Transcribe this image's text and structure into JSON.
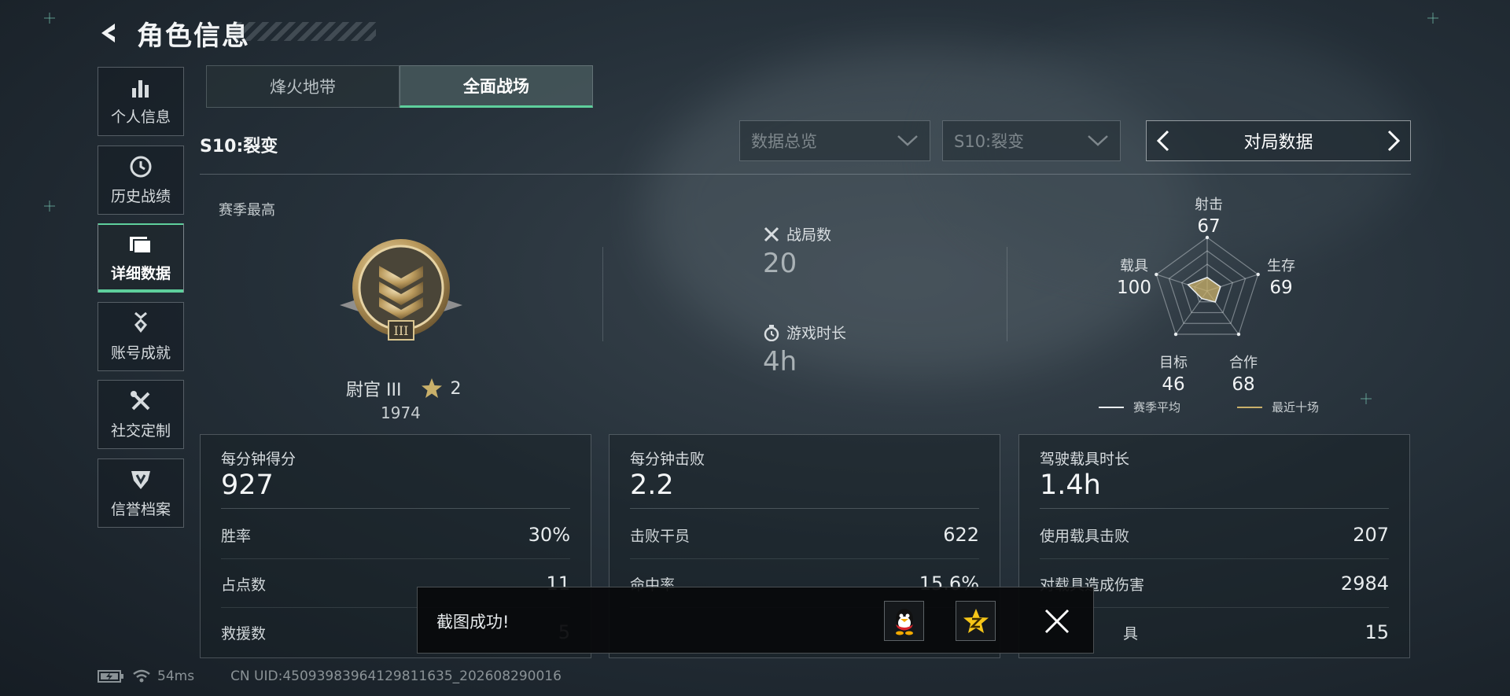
{
  "header": {
    "title": "角色信息"
  },
  "sidebar": {
    "items": [
      {
        "label": "个人信息",
        "icon": "bar-chart-icon"
      },
      {
        "label": "历史战绩",
        "icon": "clock-icon"
      },
      {
        "label": "详细数据",
        "icon": "folder-icon",
        "active": true
      },
      {
        "label": "账号成就",
        "icon": "medal-icon"
      },
      {
        "label": "社交定制",
        "icon": "tools-icon"
      },
      {
        "label": "信誉档案",
        "icon": "shield-icon"
      }
    ]
  },
  "tabs": [
    {
      "label": "烽火地带"
    },
    {
      "label": "全面战场",
      "active": true
    }
  ],
  "filters": {
    "season_label": "S10:裂变",
    "dropdown_overview": "数据总览",
    "dropdown_season": "S10:裂变",
    "stat_switch": "对局数据"
  },
  "overview": {
    "season_best_label": "赛季最高",
    "rank_name": "尉官 III",
    "rank_stars": "2",
    "rank_points": "1974",
    "rank_badge_numeral": "III",
    "matches_label": "战局数",
    "matches_value": "20",
    "playtime_label": "游戏时长",
    "playtime_value": "4h"
  },
  "radar": {
    "axes": [
      {
        "label": "射击",
        "value": 67
      },
      {
        "label": "生存",
        "value": 69
      },
      {
        "label": "合作",
        "value": 68
      },
      {
        "label": "目标",
        "value": 46
      },
      {
        "label": "载具",
        "value": 100
      }
    ],
    "legend": [
      {
        "label": "赛季平均",
        "color": "#e8ecee"
      },
      {
        "label": "最近十场",
        "color": "#c9b06a"
      }
    ]
  },
  "cards": [
    {
      "title": "每分钟得分",
      "main": "927",
      "rows": [
        {
          "label": "胜率",
          "value": "30%"
        },
        {
          "label": "占点数",
          "value": "11"
        },
        {
          "label": "救援数",
          "value": "5"
        }
      ]
    },
    {
      "title": "每分钟击败",
      "main": "2.2",
      "rows": [
        {
          "label": "击败干员",
          "value": "622"
        },
        {
          "label": "命中率",
          "value": "15.6%"
        },
        {
          "label": "",
          "value": ""
        }
      ]
    },
    {
      "title": "驾驶载具时长",
      "main": "1.4h",
      "rows": [
        {
          "label": "使用载具击败",
          "value": "207"
        },
        {
          "label": "对载具造成伤害",
          "value": "2984"
        },
        {
          "label": "具",
          "value": "15"
        }
      ]
    }
  ],
  "toast": {
    "text": "截图成功!"
  },
  "status": {
    "ping": "54ms",
    "uid": "CN UID:4509398396412981163​5_202608290016"
  },
  "colors": {
    "accent": "#5ecf9c",
    "gold": "#c9b06a"
  }
}
